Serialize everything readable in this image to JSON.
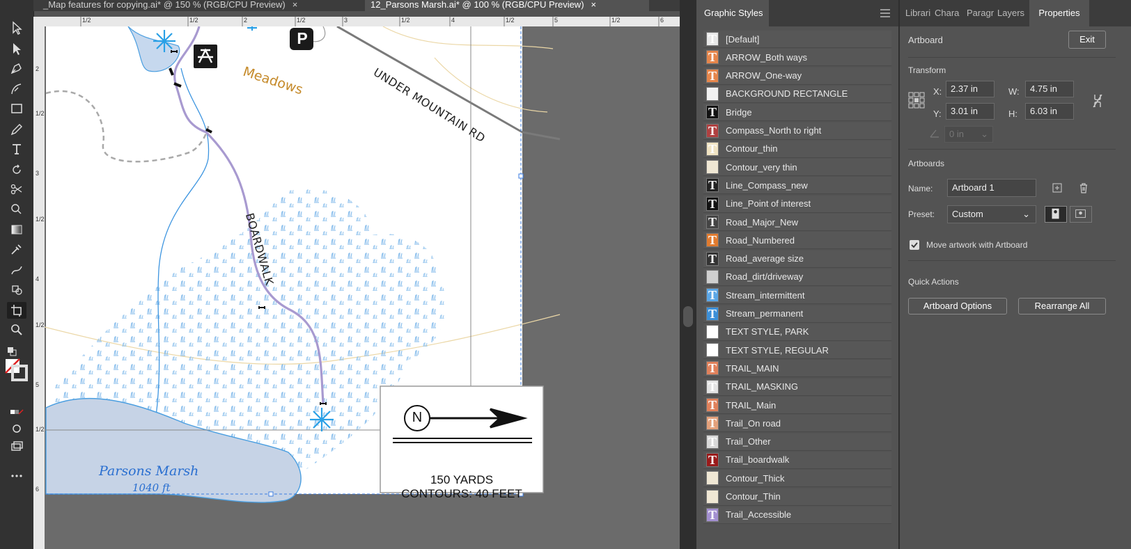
{
  "tabs": [
    {
      "label": "_Map features for copying.ai* @ 150 % (RGB/CPU Preview)",
      "close": "×"
    },
    {
      "label": "12_Parsons Marsh.ai* @ 100 % (RGB/CPU Preview)",
      "close": "×"
    }
  ],
  "ruler": {
    "top_marks": [
      "1/2",
      "1/2",
      "2",
      "1/2",
      "3",
      "1/2",
      "4",
      "1/2",
      "5",
      "1/2",
      "6"
    ],
    "left_marks": [
      "2",
      "1/2",
      "3",
      "1/2",
      "4",
      "1/2",
      "5",
      "1/2",
      "6"
    ]
  },
  "map": {
    "label_meadows": "Meadows",
    "label_road": "UNDER MOUNTAIN RD",
    "label_boardwalk": "BOARDWALK",
    "label_marsh": "Parsons Marsh",
    "label_elevation": "1040 ft",
    "parking_letter": "P",
    "compass_letter": "N",
    "scale_text": "150 YARDS",
    "contour_text": "CONTOURS: 40 FEET"
  },
  "graphic_styles": {
    "title": "Graphic Styles",
    "items": [
      {
        "name": "[Default]",
        "color": "#e8e8e8",
        "glyph": "T"
      },
      {
        "name": "ARROW_Both ways",
        "color": "#e6854a",
        "glyph": "T"
      },
      {
        "name": "ARROW_One-way",
        "color": "#e6854a",
        "glyph": "T"
      },
      {
        "name": "BACKGROUND RECTANGLE",
        "color": "#f2f2f2",
        "glyph": ""
      },
      {
        "name": "Bridge",
        "color": "#111111",
        "glyph": "T"
      },
      {
        "name": "Compass_North to right",
        "color": "#b04040",
        "glyph": "T"
      },
      {
        "name": "Contour_thin",
        "color": "#f0e3c2",
        "glyph": "T"
      },
      {
        "name": "Contour_very thin",
        "color": "#efe7d4",
        "glyph": ""
      },
      {
        "name": "Line_Compass_new",
        "color": "#222222",
        "glyph": "T"
      },
      {
        "name": "Line_Point of interest",
        "color": "#111111",
        "glyph": "T"
      },
      {
        "name": "Road_Major_New",
        "color": "#444444",
        "glyph": "T"
      },
      {
        "name": "Road_Numbered",
        "color": "#e07a2e",
        "glyph": "T"
      },
      {
        "name": "Road_average size",
        "color": "#333333",
        "glyph": "T"
      },
      {
        "name": "Road_dirt/driveway",
        "color": "#cfcfcf",
        "glyph": ""
      },
      {
        "name": "Stream_intermittent",
        "color": "#5aa6e6",
        "glyph": "T"
      },
      {
        "name": "Stream_permanent",
        "color": "#3b8fd8",
        "glyph": "T"
      },
      {
        "name": "TEXT STYLE, PARK",
        "color": "#ffffff",
        "glyph": ""
      },
      {
        "name": "TEXT STYLE, REGULAR",
        "color": "#ffffff",
        "glyph": ""
      },
      {
        "name": "TRAIL_MAIN",
        "color": "#e0805a",
        "glyph": "T"
      },
      {
        "name": "TRAIL_MASKING",
        "color": "#e2e2e2",
        "glyph": "T"
      },
      {
        "name": "TRAIL_Main",
        "color": "#e0805a",
        "glyph": "T"
      },
      {
        "name": "Trail_On road",
        "color": "#e3a07a",
        "glyph": "T"
      },
      {
        "name": "Trail_Other",
        "color": "#d8d8d8",
        "glyph": "T"
      },
      {
        "name": "Trail_boardwalk",
        "color": "#9a1a1a",
        "glyph": "T"
      },
      {
        "name": "Contour_Thick",
        "color": "#efe7d4",
        "glyph": ""
      },
      {
        "name": "Contour_Thin",
        "color": "#efe7d4",
        "glyph": ""
      },
      {
        "name": "Trail_Accessible",
        "color": "#a28fd0",
        "glyph": "T"
      }
    ]
  },
  "props_tabs": [
    "Librari",
    "Chara",
    "Paragr",
    "Layers",
    "Properties"
  ],
  "properties": {
    "section_artboard": "Artboard",
    "exit_label": "Exit",
    "transform_title": "Transform",
    "x_label": "X:",
    "x_value": "2.37 in",
    "y_label": "Y:",
    "y_value": "3.01 in",
    "w_label": "W:",
    "w_value": "4.75 in",
    "h_label": "H:",
    "h_value": "6.03 in",
    "angle_value": "0 in",
    "artboards_title": "Artboards",
    "name_label": "Name:",
    "name_value": "Artboard 1",
    "preset_label": "Preset:",
    "preset_value": "Custom",
    "move_label": "Move artwork with Artboard",
    "quick_actions_title": "Quick Actions",
    "artboard_options_label": "Artboard Options",
    "rearrange_label": "Rearrange All"
  }
}
